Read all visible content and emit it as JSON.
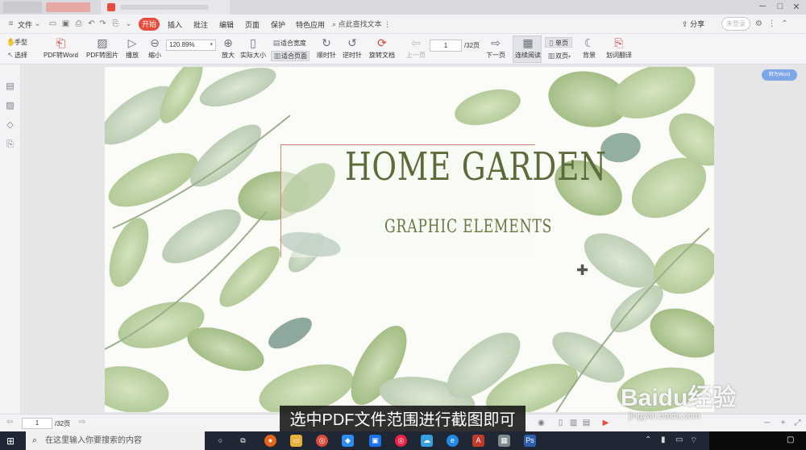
{
  "menubar": {
    "file_label": "文件",
    "tabs": [
      "开始",
      "插入",
      "批注",
      "编辑",
      "页面",
      "保护",
      "特色应用"
    ],
    "search_placeholder": "点此查找文本",
    "share_label": "分享",
    "login_label": "未登录"
  },
  "toolbar": {
    "hand_label": "手型",
    "select_label": "选择",
    "pdf_to_word": "PDF转Word",
    "pdf_to_image": "PDF转图片",
    "play": "播放",
    "zoom_out": "缩小",
    "zoom_value": "120.89%",
    "zoom_in": "放大",
    "actual_size": "实际大小",
    "fit_width": "适合宽度",
    "fit_page": "适合页面",
    "rotate_cw": "顺时针",
    "rotate_ccw": "逆时针",
    "rotate_doc": "旋转文档",
    "prev_page": "上一页",
    "page_value": "1",
    "page_count": "/32页",
    "next_page": "下一页",
    "continuous": "连续阅读",
    "single_page": "单页",
    "double_page": "双页",
    "background": "背景",
    "translate": "划词翻译"
  },
  "word_badge": "转为Word",
  "document": {
    "title": "HOME GARDEN",
    "subtitle": "GRAPHIC ELEMENTS"
  },
  "statusbar": {
    "page_value": "1",
    "page_count": "/32页"
  },
  "caption": "选中PDF文件范围进行截图即可",
  "watermark": {
    "text": "Baidu经验",
    "url": "jingyan.baidu.com"
  },
  "taskbar": {
    "search_placeholder": "在这里输入你要搜索的内容"
  },
  "colors": {
    "accent": "#e84c3d",
    "title_green": "#5d6a3a",
    "selection_border": "#d9807a"
  }
}
